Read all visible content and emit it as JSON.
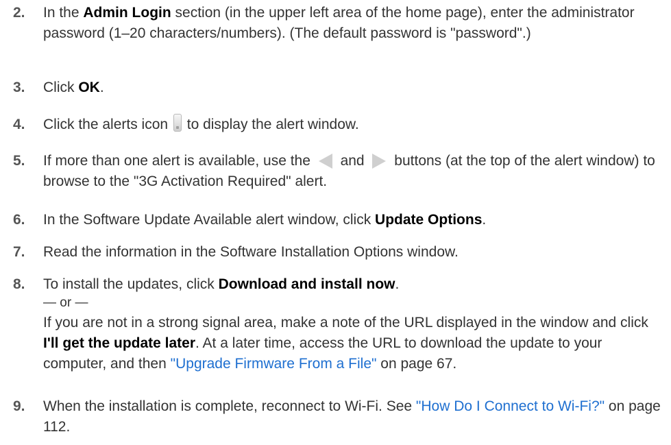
{
  "steps": [
    {
      "num": "2.",
      "a": "In the ",
      "b1": "Admin Login",
      "c": " section (in the upper left area of the home page), enter the administrator password (1–20 characters/numbers). (The default password is \"password\".)"
    },
    {
      "num": "3.",
      "a": "Click ",
      "b1": "OK",
      "c": "."
    },
    {
      "num": "4.",
      "a": "Click the alerts icon ",
      "c": " to display the alert window."
    },
    {
      "num": "5.",
      "a": "If more than one alert is available, use the ",
      "mid": " and ",
      "c": " buttons (at the top of the alert window) to browse to the \"3G Activation Required\" alert."
    },
    {
      "num": "6.",
      "a": "In the Software Update Available alert window, click ",
      "b1": "Update Options",
      "c": "."
    },
    {
      "num": "7.",
      "a": "Read the information in the Software Installation Options window."
    },
    {
      "num": "8.",
      "a": "To install the updates, click ",
      "b1": "Download and install now",
      "c": ".",
      "or": "— or —",
      "p2a": "If you are not in a strong signal area, make a note of the URL displayed in the window and click ",
      "p2b": "I'll get the update later",
      "p2c": ". At a later time, access the URL to download the update to your computer, and then ",
      "p2link": "\"Upgrade Firmware From a File\"",
      "p2d": " on page 67."
    },
    {
      "num": "9.",
      "a": "When the installation is complete, reconnect to Wi-Fi. See ",
      "link": "\"How Do I Connect to Wi-Fi?\"",
      "c": " on page 112."
    }
  ],
  "icons": {
    "alerts": "alert-bell-icon",
    "prev": "previous-alert-arrow-icon",
    "next": "next-alert-arrow-icon"
  }
}
